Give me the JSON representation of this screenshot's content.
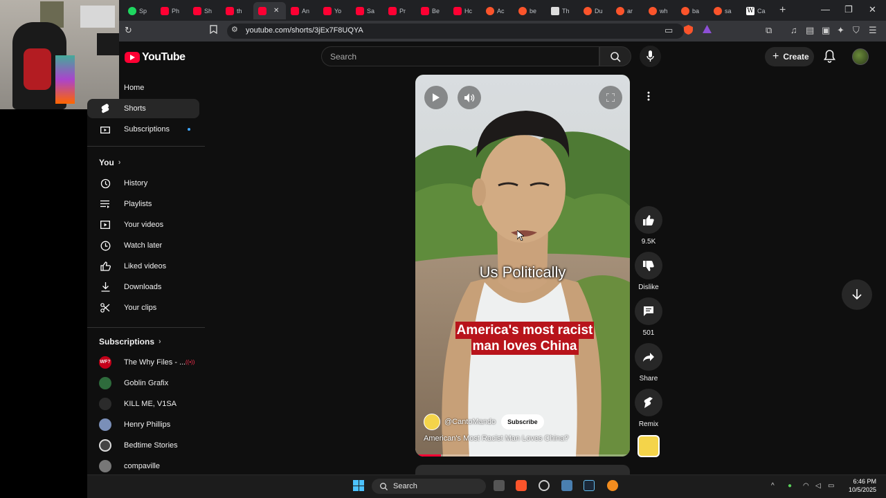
{
  "browser": {
    "tabs": [
      {
        "label": "Sp",
        "favicon": "spotify-icon"
      },
      {
        "label": "Ph",
        "favicon": "youtube-icon"
      },
      {
        "label": "Sh",
        "favicon": "youtube-icon"
      },
      {
        "label": "th",
        "favicon": "youtube-icon"
      },
      {
        "label": "",
        "favicon": "youtube-icon",
        "active": true
      },
      {
        "label": "An",
        "favicon": "youtube-icon"
      },
      {
        "label": "Yo",
        "favicon": "youtube-icon"
      },
      {
        "label": "Sa",
        "favicon": "youtube-icon"
      },
      {
        "label": "Pr",
        "favicon": "youtube-icon"
      },
      {
        "label": "Be",
        "favicon": "youtube-icon"
      },
      {
        "label": "Hc",
        "favicon": "youtube-icon"
      },
      {
        "label": "Ac",
        "favicon": "brave-icon"
      },
      {
        "label": "be",
        "favicon": "brave-icon"
      },
      {
        "label": "Th",
        "favicon": "news-icon"
      },
      {
        "label": "Du",
        "favicon": "brave-icon"
      },
      {
        "label": "ar",
        "favicon": "brave-icon"
      },
      {
        "label": "wh",
        "favicon": "brave-icon"
      },
      {
        "label": "ba",
        "favicon": "brave-icon"
      },
      {
        "label": "sa",
        "favicon": "brave-icon"
      },
      {
        "label": "Ca",
        "favicon": "wikipedia-icon"
      }
    ],
    "url": "youtube.com/shorts/3jEx7F8UQYA"
  },
  "youtube": {
    "logo_text": "YouTube",
    "search_placeholder": "Search",
    "create_label": "Create",
    "brand_color": "#ff0033"
  },
  "sidebar": {
    "main": [
      {
        "label": "Home",
        "icon": "home-icon"
      },
      {
        "label": "Shorts",
        "icon": "shorts-icon",
        "selected": true
      },
      {
        "label": "Subscriptions",
        "icon": "subscriptions-icon"
      }
    ],
    "you_heading": "You",
    "you_items": [
      {
        "label": "History",
        "icon": "history-icon"
      },
      {
        "label": "Playlists",
        "icon": "playlists-icon"
      },
      {
        "label": "Your videos",
        "icon": "your-videos-icon"
      },
      {
        "label": "Watch later",
        "icon": "watch-later-icon"
      },
      {
        "label": "Liked videos",
        "icon": "liked-videos-icon"
      },
      {
        "label": "Downloads",
        "icon": "downloads-icon"
      },
      {
        "label": "Your clips",
        "icon": "clips-icon"
      }
    ],
    "subs_heading": "Subscriptions",
    "subscriptions": [
      {
        "label": "The Why Files - ...",
        "live": true,
        "color": "#c4001a"
      },
      {
        "label": "Goblin Grafix",
        "color": "#2e6b3c"
      },
      {
        "label": "KILL ME, V1SA",
        "color": "#2b2b2b"
      },
      {
        "label": "Henry Phillips",
        "color": "#7a8fb8"
      },
      {
        "label": "Bedtime Stories",
        "color": "#444444"
      },
      {
        "label": "compaville",
        "color": "#777777"
      }
    ]
  },
  "short": {
    "caption_top": "Us Politically",
    "caption_bottom": "America's most racist man loves China",
    "channel": "@CantoMando",
    "subscribe_label": "Subscribe",
    "title": "American's Most Racist Man Loves China?",
    "progress": 0.12
  },
  "actions": {
    "likes": "9.5K",
    "dislike_label": "Dislike",
    "comments": "501",
    "share_label": "Share",
    "remix_label": "Remix"
  },
  "taskbar": {
    "search_label": "Search",
    "time": "6:46 PM",
    "date": "10/5/2025"
  }
}
